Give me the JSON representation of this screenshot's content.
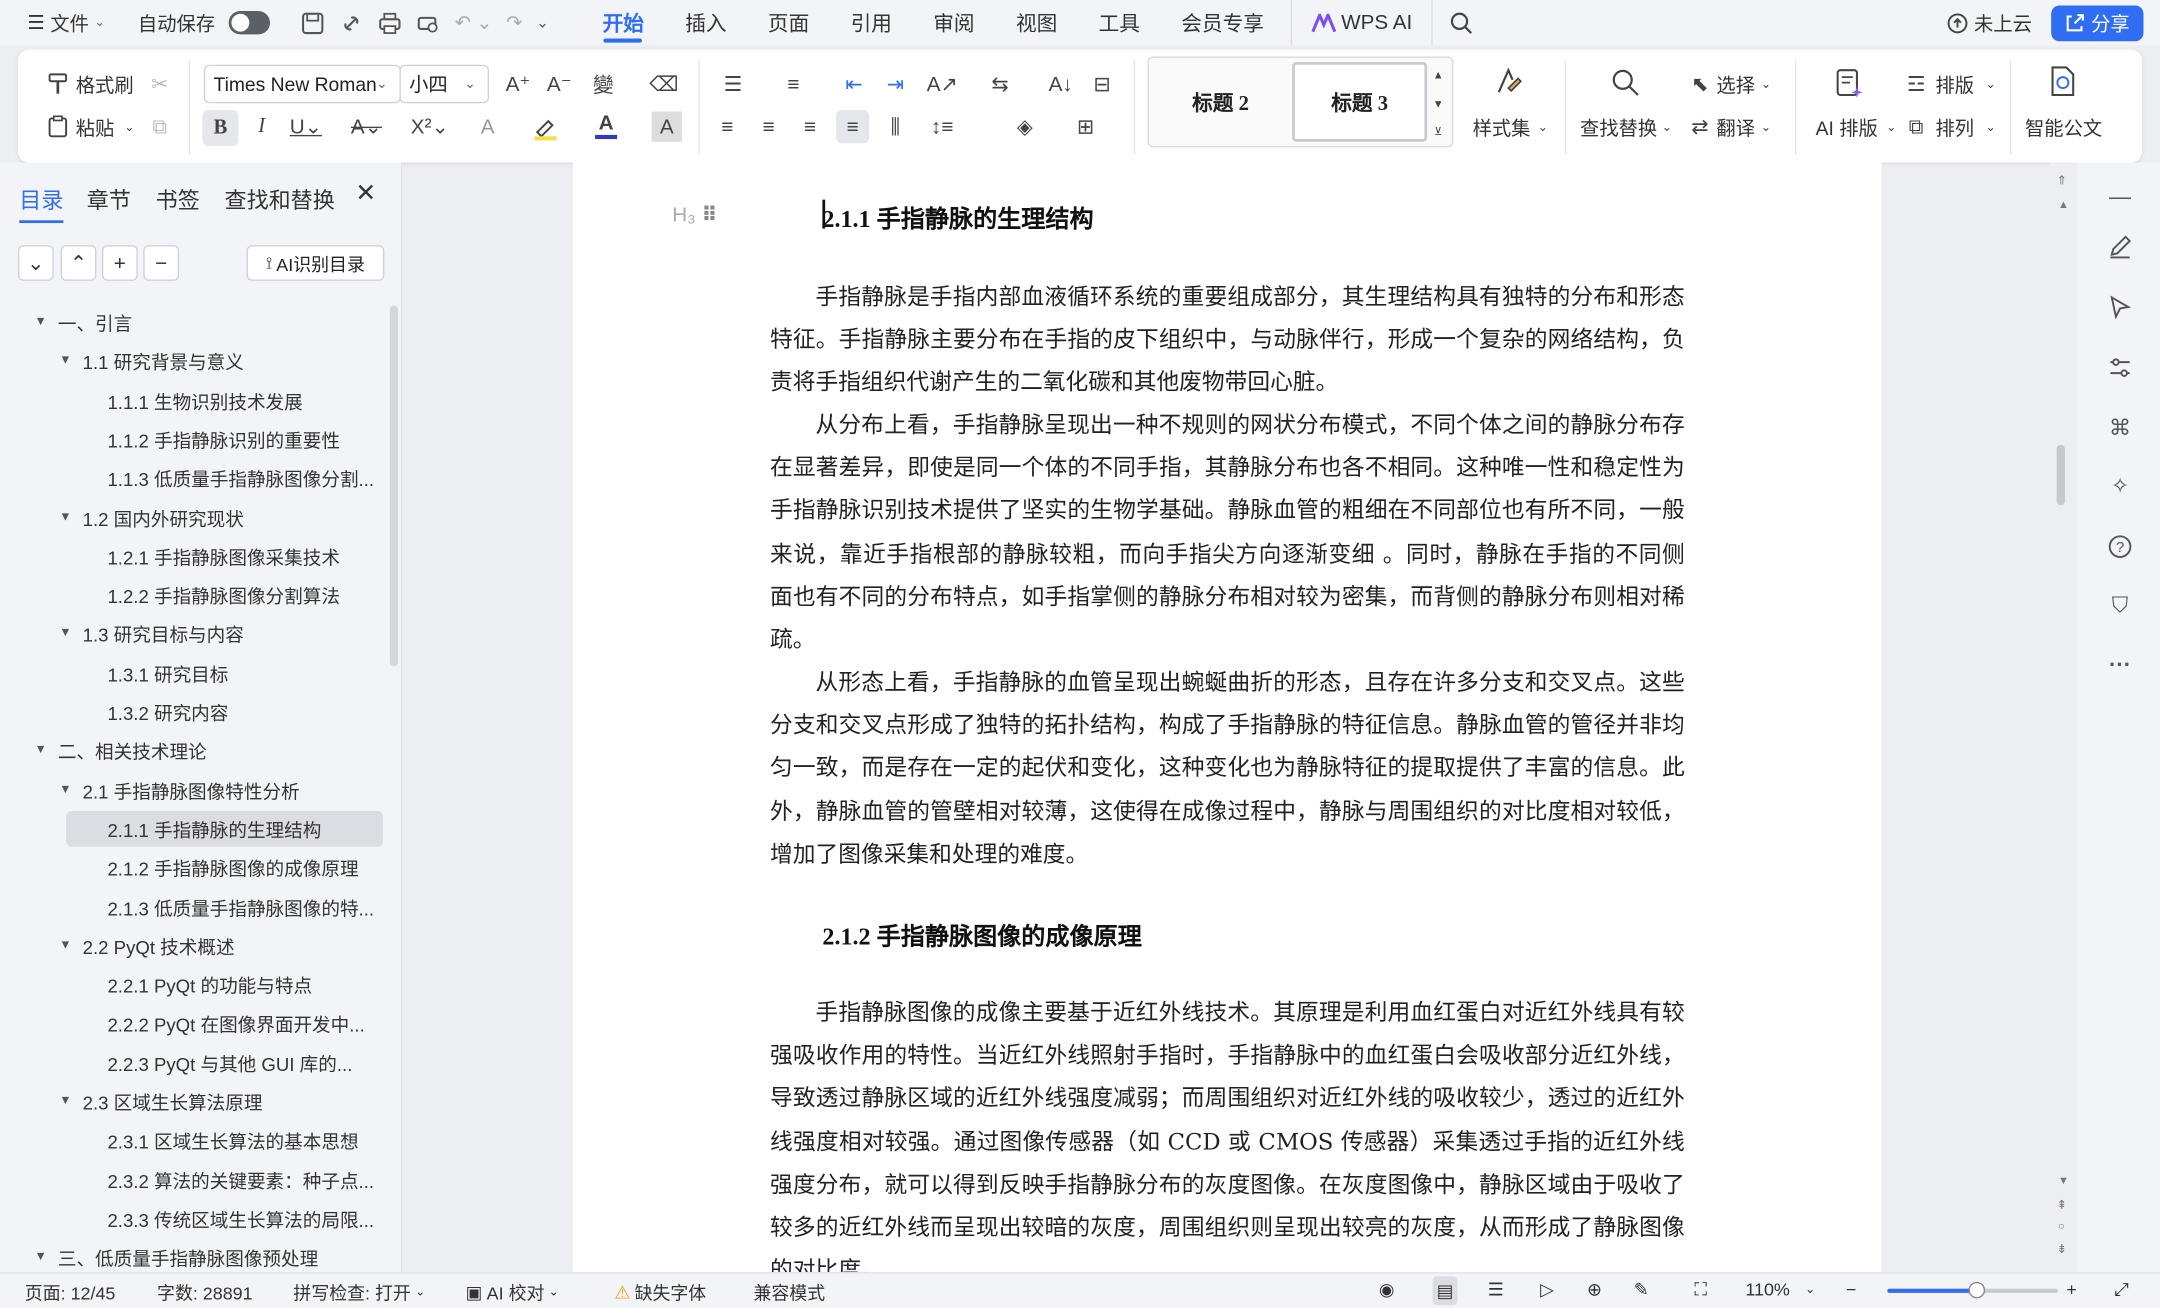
{
  "menubar": {
    "file_label": "文件",
    "autosave_label": "自动保存",
    "tabs": [
      "开始",
      "插入",
      "页面",
      "引用",
      "审阅",
      "视图",
      "工具",
      "会员专享"
    ],
    "wps_ai_label": "WPS AI",
    "cloud_label": "未上云",
    "share_label": "分享"
  },
  "ribbon": {
    "format_painter": "格式刷",
    "paste": "粘贴",
    "font_name": "Times New Roman",
    "font_size": "小四",
    "style_cards": [
      "标题 2",
      "标题 3"
    ],
    "styles_label": "样式集",
    "find_replace": "查找替换",
    "select": "选择",
    "translate": "翻译",
    "ai_layout": "AI 排版",
    "layout": "排版",
    "arrange": "排列",
    "smart_doc": "智能公文"
  },
  "sidebar": {
    "tabs": [
      "目录",
      "章节",
      "书签",
      "查找和替换"
    ],
    "ai_toc_label": "AI识别目录",
    "toc": [
      {
        "label": "一、引言"
      },
      {
        "label": "1.1  研究背景与意义"
      },
      {
        "label": "1.1.1  生物识别技术发展"
      },
      {
        "label": "1.1.2  手指静脉识别的重要性"
      },
      {
        "label": "1.1.3  低质量手指静脉图像分割..."
      },
      {
        "label": "1.2  国内外研究现状"
      },
      {
        "label": "1.2.1  手指静脉图像采集技术"
      },
      {
        "label": "1.2.2  手指静脉图像分割算法"
      },
      {
        "label": "1.3  研究目标与内容"
      },
      {
        "label": "1.3.1  研究目标"
      },
      {
        "label": "1.3.2  研究内容"
      },
      {
        "label": "二、相关技术理论"
      },
      {
        "label": "2.1  手指静脉图像特性分析"
      },
      {
        "label": "2.1.1  手指静脉的生理结构"
      },
      {
        "label": "2.1.2  手指静脉图像的成像原理"
      },
      {
        "label": "2.1.3  低质量手指静脉图像的特..."
      },
      {
        "label": "2.2 PyQt  技术概述"
      },
      {
        "label": "2.2.1 PyQt  的功能与特点"
      },
      {
        "label": "2.2.2 PyQt  在图像界面开发中..."
      },
      {
        "label": "2.2.3 PyQt  与其他  GUI  库的..."
      },
      {
        "label": "2.3  区域生长算法原理"
      },
      {
        "label": "2.3.1  区域生长算法的基本思想"
      },
      {
        "label": "2.3.2  算法的关键要素：种子点..."
      },
      {
        "label": "2.3.3  传统区域生长算法的局限..."
      },
      {
        "label": "三、低质量手指静脉图像预处理"
      }
    ]
  },
  "document": {
    "heading1": "2.1.1  手指静脉的生理结构",
    "p1": "手指静脉是手指内部血液循环系统的重要组成部分，其生理结构具有独特的分布和形态特征。手指静脉主要分布在手指的皮下组织中，与动脉伴行，形成一个复杂的网络结构，负责将手指组织代谢产生的二氧化碳和其他废物带回心脏。",
    "p2": "从分布上看，手指静脉呈现出一种不规则的网状分布模式，不同个体之间的静脉分布存在显著差异，即使是同一个体的不同手指，其静脉分布也各不相同。这种唯一性和稳定性为手指静脉识别技术提供了坚实的生物学基础。静脉血管的粗细在不同部位也有所不同，一般来说，靠近手指根部的静脉较粗，而向手指尖方向逐渐变细 。同时，静脉在手指的不同侧面也有不同的分布特点，如手指掌侧的静脉分布相对较为密集，而背侧的静脉分布则相对稀疏。",
    "p3": "从形态上看，手指静脉的血管呈现出蜿蜒曲折的形态，且存在许多分支和交叉点。这些分支和交叉点形成了独特的拓扑结构，构成了手指静脉的特征信息。静脉血管的管径并非均匀一致，而是存在一定的起伏和变化，这种变化也为静脉特征的提取提供了丰富的信息。此外，静脉血管的管壁相对较薄，这使得在成像过程中，静脉与周围组织的对比度相对较低，增加了图像采集和处理的难度。",
    "heading2": "2.1.2  手指静脉图像的成像原理",
    "p4": "手指静脉图像的成像主要基于近红外线技术。其原理是利用血红蛋白对近红外线具有较强吸收作用的特性。当近红外线照射手指时，手指静脉中的血红蛋白会吸收部分近红外线，导致透过静脉区域的近红外线强度减弱；而周围组织对近红外线的吸收较少，透过的近红外线强度相对较强。通过图像传感器（如  CCD  或 CMOS  传感器）采集透过手指的近红外线强度分布，就可以得到反映手指静脉分布的灰度图像。在灰度图像中，静脉区域由于吸收了较多的近红外线而呈现出较暗的灰度，周围组织则呈现出较亮的灰度，从而形成了静脉图像的对比度。"
  },
  "statusbar": {
    "page": "页面: 12/45",
    "words": "字数: 28891",
    "spell": "拼写检查: 打开",
    "ai_proof": "AI 校对",
    "missing_font": "缺失字体",
    "compat": "兼容模式",
    "zoom": "110%",
    "zoom_level_pct": 110
  },
  "colors": {
    "accent": "#2f6ef3",
    "selected_toc_bg": "#dcdde2",
    "chrome_bg": "#f3f4f7"
  }
}
